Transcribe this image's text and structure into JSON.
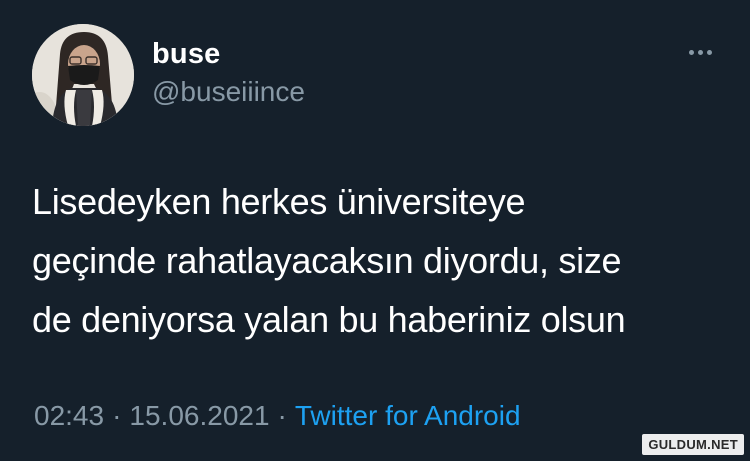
{
  "user": {
    "display_name": "buse",
    "handle": "@buseiiince"
  },
  "tweet": {
    "text_lines": [
      "Lisedeyken herkes üniversiteye",
      "geçinde rahatlayacaksın diyordu, size",
      "de deniyorsa yalan bu haberiniz olsun"
    ],
    "time": "02:43",
    "date": "15.06.2021",
    "separator": "·",
    "source": "Twitter for Android"
  },
  "icons": {
    "more": "more-horizontal-icon",
    "avatar": "profile-photo"
  },
  "watermark": "GULDUM.NET",
  "colors": {
    "background": "#15202b",
    "primary_text": "#ffffff",
    "secondary_text": "#8899a6",
    "accent": "#1da1f2"
  }
}
